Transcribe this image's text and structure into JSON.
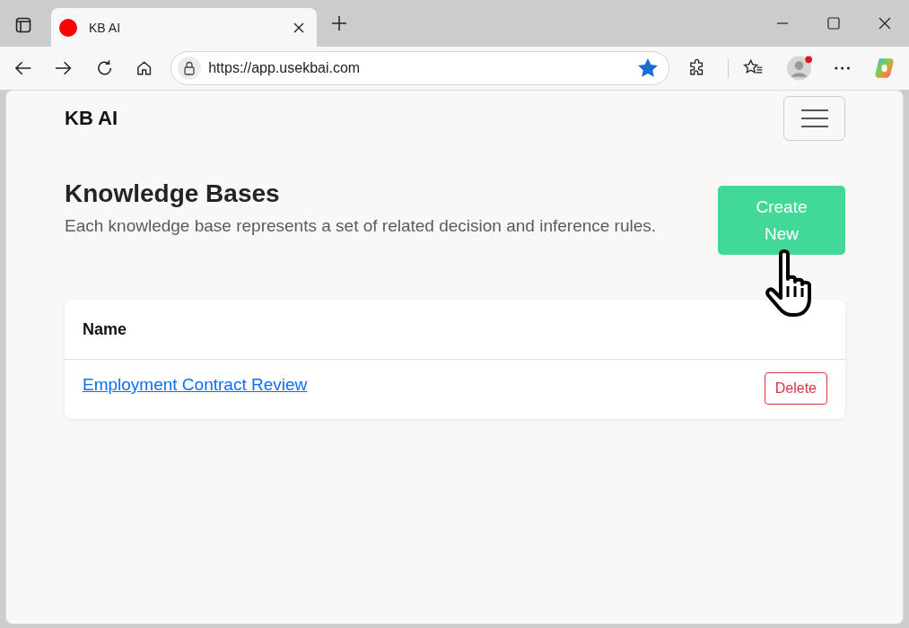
{
  "browser": {
    "tab_title": "KB AI",
    "url": "https://app.usekbai.com",
    "favorited": true
  },
  "navbar": {
    "brand": "KB AI"
  },
  "header": {
    "title": "Knowledge Bases",
    "description": "Each knowledge base represents a set of related decision and inference rules.",
    "create_button": "Create New"
  },
  "table": {
    "columns": [
      "Name"
    ],
    "rows": [
      {
        "name": "Employment Contract Review",
        "action": "Delete"
      }
    ]
  }
}
